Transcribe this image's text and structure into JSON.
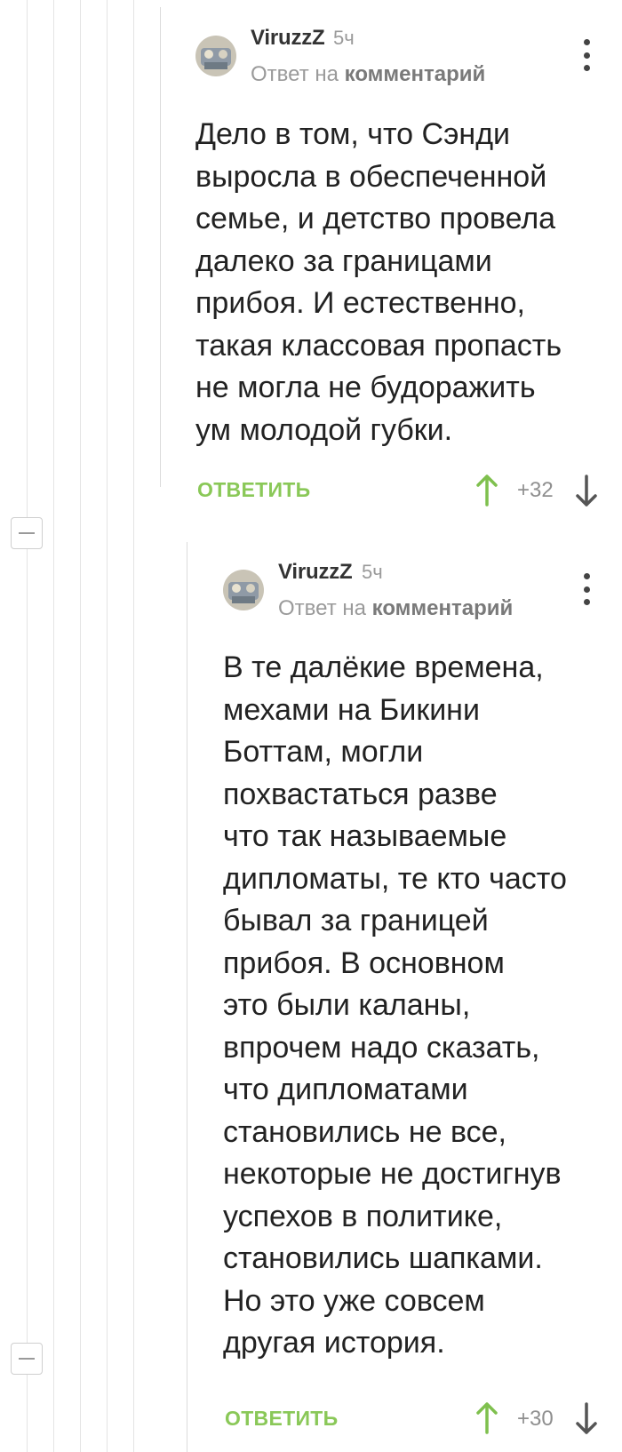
{
  "comments": [
    {
      "author": "ViruzzZ",
      "time": "5ч",
      "reply_prefix": "Ответ на",
      "reply_link": "комментарий",
      "text": "Дело в том, что Сэнди\nвыросла в обеспеченной\nсемье, и детство провела\nдалеко за границами\nприбоя. И естественно,\nтакая классовая пропасть\nне могла не будоражить\nум молодой губки.",
      "reply_label": "ОТВЕТИТЬ",
      "score": "+32"
    },
    {
      "author": "ViruzzZ",
      "time": "5ч",
      "reply_prefix": "Ответ на",
      "reply_link": "комментарий",
      "text": "В те далёкие времена,\nмехами на Бикини\nБоттам, могли\nпохвастаться разве\nчто так называемые\nдипломаты, те кто часто\nбывал за границей\nприбоя. В основном\nэто были каланы,\nвпрочем надо сказать,\nчто дипломатами\nстановились не все,\nнекоторые не достигнув\nуспехов в политике,\nстановились шапками.\nНо это уже совсем\nдругая история.",
      "reply_label": "ОТВЕТИТЬ",
      "score": "+30"
    }
  ],
  "colors": {
    "accent_green": "#8ac858",
    "upvote_green": "#7fc04e",
    "muted": "#9a9a9a",
    "thread_line": "#e4e4e4"
  },
  "icons": [
    "collapse-icon",
    "avatar",
    "more-icon",
    "upvote-arrow-icon",
    "downvote-arrow-icon"
  ]
}
